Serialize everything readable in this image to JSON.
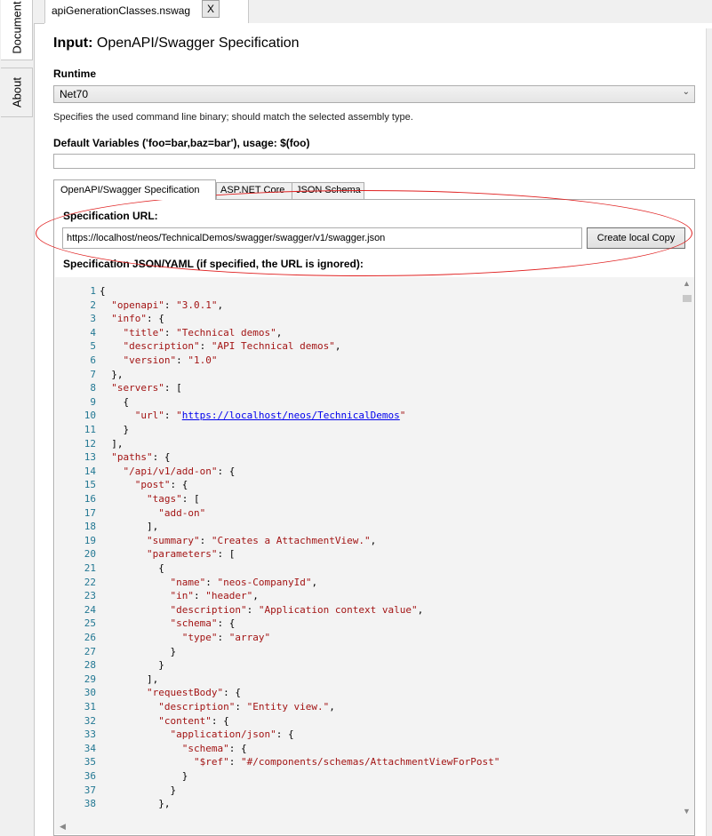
{
  "side_tabs": {
    "documents": "Document",
    "about": "About"
  },
  "file_tab": {
    "label": "apiGenerationClasses.nswag",
    "close": "X"
  },
  "input": {
    "heading_bold": "Input:",
    "heading_rest": " OpenAPI/Swagger Specification"
  },
  "runtime": {
    "label": "Runtime",
    "value": "Net70",
    "help": "Specifies the used command line binary; should match the selected assembly type."
  },
  "default_variables": {
    "label": "Default Variables ('foo=bar,baz=bar'), usage: $(foo)",
    "value": ""
  },
  "inner_tabs": [
    "OpenAPI/Swagger Specification",
    "ASP.NET Core",
    "JSON Schema"
  ],
  "spec_url": {
    "label": "Specification URL:",
    "value": "https://localhost/neos/TechnicalDemos/swagger/swagger/v1/swagger.json",
    "button": "Create local Copy"
  },
  "spec_json_label": "Specification JSON/YAML (if specified, the URL is ignored):",
  "annotation_color": "#e02020",
  "code": [
    {
      "n": "1",
      "t": "{"
    },
    {
      "n": "2",
      "t": "  \"openapi\": \"3.0.1\","
    },
    {
      "n": "3",
      "t": "  \"info\": {"
    },
    {
      "n": "4",
      "t": "    \"title\": \"Technical demos\","
    },
    {
      "n": "5",
      "t": "    \"description\": \"API Technical demos\","
    },
    {
      "n": "6",
      "t": "    \"version\": \"1.0\""
    },
    {
      "n": "7",
      "t": "  },"
    },
    {
      "n": "8",
      "t": "  \"servers\": ["
    },
    {
      "n": "9",
      "t": "    {"
    },
    {
      "n": "10",
      "t": "      \"url\": \"https://localhost/neos/TechnicalDemos\""
    },
    {
      "n": "11",
      "t": "    }"
    },
    {
      "n": "12",
      "t": "  ],"
    },
    {
      "n": "13",
      "t": "  \"paths\": {"
    },
    {
      "n": "14",
      "t": "    \"/api/v1/add-on\": {"
    },
    {
      "n": "15",
      "t": "      \"post\": {"
    },
    {
      "n": "16",
      "t": "        \"tags\": ["
    },
    {
      "n": "17",
      "t": "          \"add-on\""
    },
    {
      "n": "18",
      "t": "        ],"
    },
    {
      "n": "19",
      "t": "        \"summary\": \"Creates a AttachmentView.\","
    },
    {
      "n": "20",
      "t": "        \"parameters\": ["
    },
    {
      "n": "21",
      "t": "          {"
    },
    {
      "n": "22",
      "t": "            \"name\": \"neos-CompanyId\","
    },
    {
      "n": "23",
      "t": "            \"in\": \"header\","
    },
    {
      "n": "24",
      "t": "            \"description\": \"Application context value\","
    },
    {
      "n": "25",
      "t": "            \"schema\": {"
    },
    {
      "n": "26",
      "t": "              \"type\": \"array\""
    },
    {
      "n": "27",
      "t": "            }"
    },
    {
      "n": "28",
      "t": "          }"
    },
    {
      "n": "29",
      "t": "        ],"
    },
    {
      "n": "30",
      "t": "        \"requestBody\": {"
    },
    {
      "n": "31",
      "t": "          \"description\": \"Entity view.\","
    },
    {
      "n": "32",
      "t": "          \"content\": {"
    },
    {
      "n": "33",
      "t": "            \"application/json\": {"
    },
    {
      "n": "34",
      "t": "              \"schema\": {"
    },
    {
      "n": "35",
      "t": "                \"$ref\": \"#/components/schemas/AttachmentViewForPost\""
    },
    {
      "n": "36",
      "t": "              }"
    },
    {
      "n": "37",
      "t": "            }"
    },
    {
      "n": "38",
      "t": "          },"
    }
  ]
}
